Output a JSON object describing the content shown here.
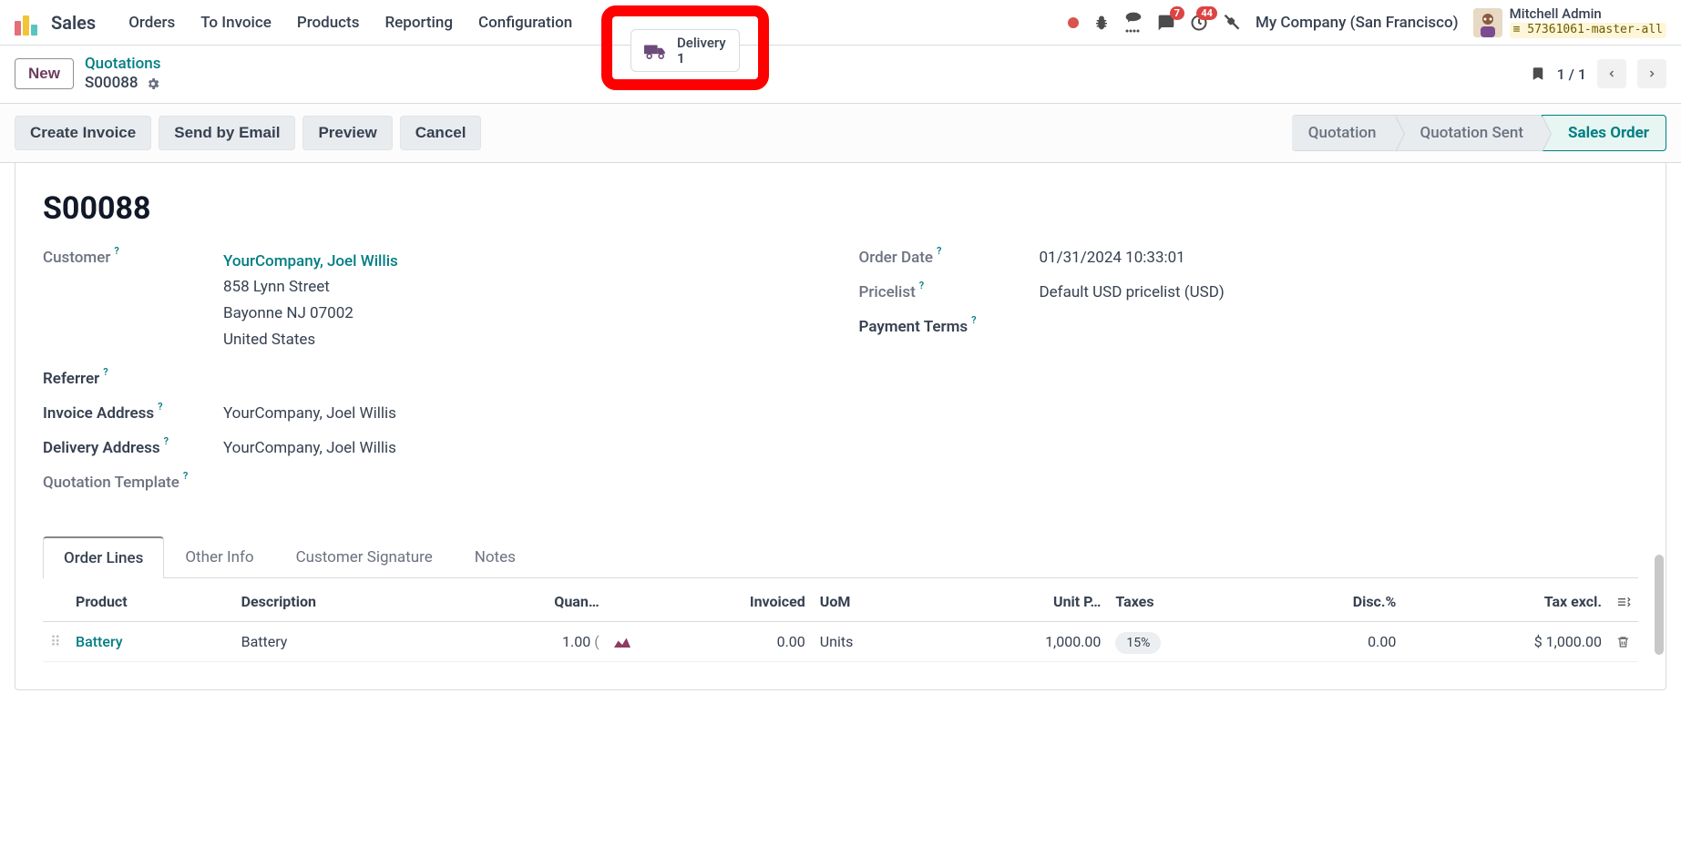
{
  "app": "Sales",
  "nav": [
    "Orders",
    "To Invoice",
    "Products",
    "Reporting",
    "Configuration"
  ],
  "topright": {
    "messages_badge": "7",
    "activities_badge": "44",
    "company": "My Company (San Francisco)",
    "user_name": "Mitchell Admin",
    "db_name": "57361061-master-all"
  },
  "breadcrumb": {
    "new": "New",
    "top": "Quotations",
    "bottom": "S00088"
  },
  "delivery": {
    "label": "Delivery",
    "count": "1"
  },
  "pager": {
    "pos": "1 / 1"
  },
  "actions": {
    "create_invoice": "Create Invoice",
    "send_email": "Send by Email",
    "preview": "Preview",
    "cancel": "Cancel"
  },
  "status_steps": [
    "Quotation",
    "Quotation Sent",
    "Sales Order"
  ],
  "doc": {
    "name": "S00088"
  },
  "left": {
    "customer_label": "Customer",
    "customer_link": "YourCompany, Joel Willis",
    "addr1": "858 Lynn Street",
    "addr2": "Bayonne NJ 07002",
    "addr3": "United States",
    "referrer_label": "Referrer",
    "inv_addr_label": "Invoice Address",
    "inv_addr_val": "YourCompany, Joel Willis",
    "del_addr_label": "Delivery Address",
    "del_addr_val": "YourCompany, Joel Willis",
    "quote_tmpl_label": "Quotation Template"
  },
  "right": {
    "order_date_label": "Order Date",
    "order_date_val": "01/31/2024 10:33:01",
    "pricelist_label": "Pricelist",
    "pricelist_val": "Default USD pricelist (USD)",
    "payment_terms_label": "Payment Terms"
  },
  "tabs": [
    "Order Lines",
    "Other Info",
    "Customer Signature",
    "Notes"
  ],
  "table": {
    "headers": {
      "product": "Product",
      "description": "Description",
      "quantity": "Quan…",
      "invoiced": "Invoiced",
      "uom": "UoM",
      "unit_price": "Unit P…",
      "taxes": "Taxes",
      "disc": "Disc.%",
      "tax_excl": "Tax excl."
    },
    "row": {
      "product": "Battery",
      "description": "Battery",
      "quantity": "1.00",
      "qty_suffix": "(",
      "invoiced": "0.00",
      "uom": "Units",
      "unit_price": "1,000.00",
      "tax": "15%",
      "disc": "0.00",
      "tax_excl": "$ 1,000.00"
    }
  }
}
